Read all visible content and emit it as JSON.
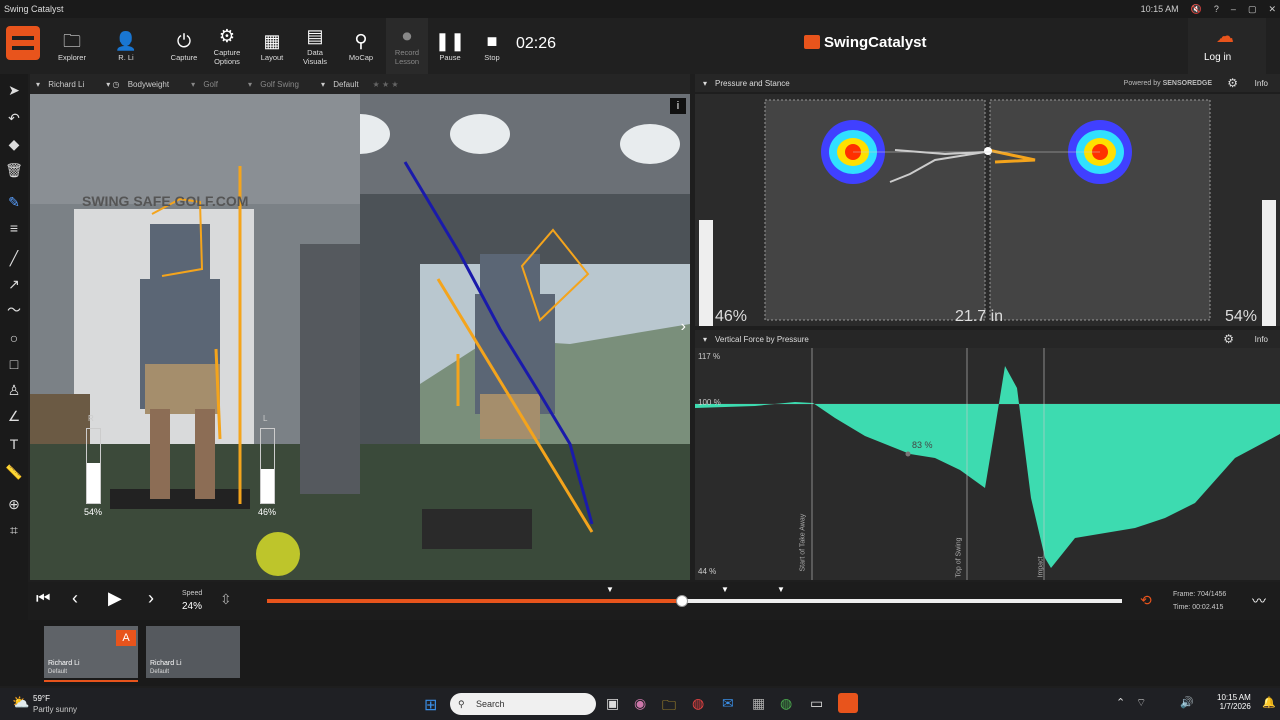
{
  "window": {
    "title": "Swing Catalyst",
    "time": "10:15 AM"
  },
  "toolbar": {
    "explorer": "Explorer",
    "user": "R. Li",
    "capture": "Capture",
    "capture_options": "Capture Options",
    "layout": "Layout",
    "data_visuals": "Data Visuals",
    "mocap": "MoCap",
    "record_lesson": "Record Lesson",
    "pause": "Pause",
    "stop": "Stop",
    "timer": "02:26",
    "brand": "SwingCatalyst",
    "login": "Log in"
  },
  "video_bar": {
    "player": "Richard Li",
    "weight": "Bodyweight",
    "sport": "Golf",
    "category": "Golf Swing",
    "preset": "Default"
  },
  "video_left": {
    "left_pct": "54%",
    "right_pct": "46%",
    "left_label": "R",
    "right_label": "L",
    "left_fill": 0.54,
    "right_fill": 0.46
  },
  "pressure": {
    "title": "Pressure and Stance",
    "powered_by": "Powered by",
    "sensor_brand": "SENSOREDGE",
    "info": "Info",
    "left_pct": "46%",
    "right_pct": "54%",
    "stance": "21.7 in"
  },
  "vertical_force": {
    "title": "Vertical Force by Pressure",
    "info": "Info",
    "y_max": "117 %",
    "y_100": "100 %",
    "y_min": "44 %",
    "point_label": "83 %",
    "markers": [
      "Start of Take Away",
      "Top of Swing",
      "Impact"
    ]
  },
  "playback": {
    "speed_label": "Speed",
    "speed": "24%",
    "frame_label": "Frame:",
    "frame": "704/1456",
    "time_label": "Time:",
    "time": "00:02.415",
    "progress": 0.485
  },
  "clips": [
    {
      "name": "Richard Li",
      "preset": "Default",
      "badge": "A"
    },
    {
      "name": "Richard Li",
      "preset": "Default"
    }
  ],
  "taskbar": {
    "weather_temp": "59°F",
    "weather_desc": "Partly sunny",
    "search_placeholder": "Search",
    "clock_time": "10:15 AM",
    "clock_date": "1/7/2026"
  },
  "colors": {
    "accent": "#e8541c",
    "force": "#3ddbb0",
    "club": "#1a1aaa",
    "lines": "#f4a41c"
  }
}
